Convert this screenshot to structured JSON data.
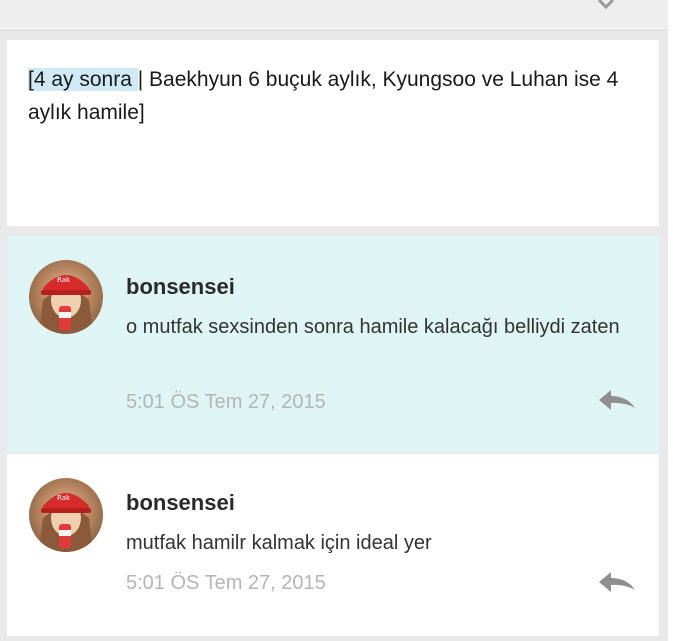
{
  "story": {
    "highlight": "[4 ay sonra ",
    "text": "| Baekhyun 6 buçuk aylık, Kyungsoo ve Luhan ise 4 aylık hamile]"
  },
  "comments": [
    {
      "author": "bonsensei",
      "text": "o mutfak sexsinden sonra hamile kalacağı belliydi zaten",
      "time": "5:01 ÖS Tem 27, 2015"
    },
    {
      "author": "bonsensei",
      "text": "mutfak hamilr kalmak için ideal yer",
      "time": "5:01 ÖS Tem 27, 2015"
    }
  ],
  "icons": {
    "reply": "reply-icon",
    "chevron": "chevron-down-icon",
    "avatar": "avatar"
  },
  "colors": {
    "highlight_bg": "#dff4f4",
    "text_highlight": "#cfe9f5"
  }
}
